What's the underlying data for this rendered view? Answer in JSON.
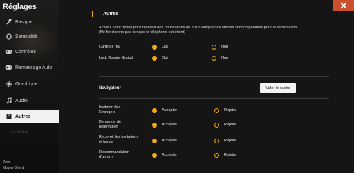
{
  "sidebar": {
    "title": "Réglages",
    "items": [
      {
        "label": "Basique",
        "icon": "wrench-icon"
      },
      {
        "label": "Sensibilité",
        "icon": "crosshair-icon"
      },
      {
        "label": "Contrôles",
        "icon": "gamepad-icon"
      },
      {
        "label": "Ramassage Auto",
        "icon": "gamepad-icon"
      },
      {
        "label": "Graphique",
        "icon": "settings-icon"
      },
      {
        "label": "Audio",
        "icon": "music-note-icon"
      },
      {
        "label": "Autres",
        "icon": "book-icon"
      }
    ],
    "ghost_label": "ARMES",
    "zone_label": "Zone",
    "zone_value": "Moyen Orient"
  },
  "main": {
    "section_title": "Autres",
    "description": "Activez cette option pour recevoir des notifications de push lorsque des articles sont disponibles pour la réclamation. (Ne fonctionne pas lorsque le téléphone est éteint)",
    "push_rows": [
      {
        "label": "Carte de feu",
        "on_label": "Oui",
        "off_label": "Non"
      },
      {
        "label": "Luck Royale Gratuit",
        "on_label": "Oui",
        "off_label": "Non"
      }
    ],
    "browser_title": "Navigateur",
    "clear_cache_label": "Vider le cache",
    "invite_rows": [
      {
        "label": "Invitaion des Étrangers",
        "accept": "Accepter",
        "reject": "Rejeter"
      },
      {
        "label": "Demande de réservation",
        "accept": "Accepter",
        "reject": "Rejeter"
      },
      {
        "label": "Recevoir les invitations et les de",
        "accept": "Accepter",
        "reject": "Rejeter"
      },
      {
        "label": "Recommandation d'un ami",
        "accept": "Accepter",
        "reject": "Rejeter"
      }
    ]
  },
  "colors": {
    "accent": "#f2a80f",
    "close": "#c8502c"
  }
}
